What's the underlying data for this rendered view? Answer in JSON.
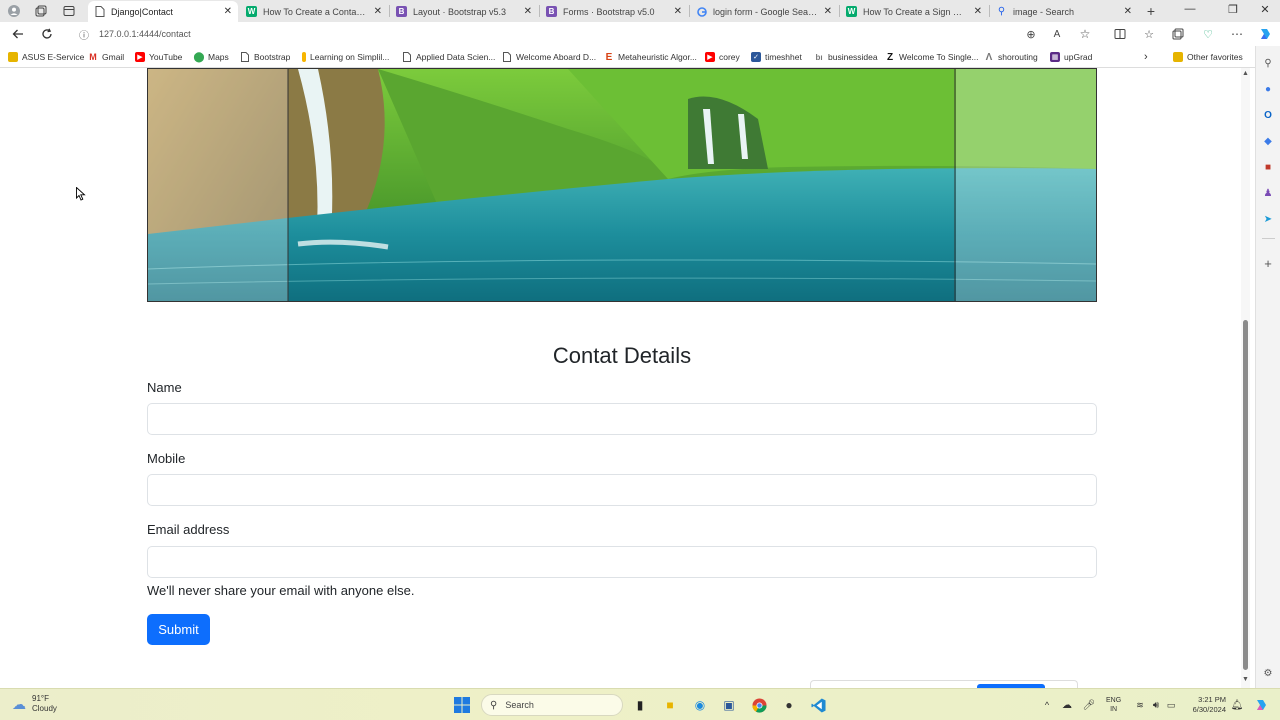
{
  "browser": {
    "tabs": [
      {
        "title": "Django|Contact",
        "active": true,
        "icon": "page-icon"
      },
      {
        "title": "How To Create a Contact Form",
        "active": false,
        "icon": "w-logo-icon"
      },
      {
        "title": "Layout · Bootstrap v5.3",
        "active": false,
        "icon": "bootstrap-logo-icon"
      },
      {
        "title": "Forms · Bootstrap v5.0",
        "active": false,
        "icon": "bootstrap-logo-icon"
      },
      {
        "title": "login form - Google Search",
        "active": false,
        "icon": "google-logo-icon"
      },
      {
        "title": "How To Create a Sign Up Form",
        "active": false,
        "icon": "w-logo-icon"
      },
      {
        "title": "image - Search",
        "active": false,
        "icon": "bing-search-icon"
      }
    ],
    "address": "127.0.0.1:4444/contact",
    "bookmarks": [
      {
        "label": "ASUS E-Service",
        "icon": "folder-icon"
      },
      {
        "label": "Gmail",
        "icon": "gmail-icon"
      },
      {
        "label": "YouTube",
        "icon": "youtube-icon"
      },
      {
        "label": "Maps",
        "icon": "maps-pin-icon"
      },
      {
        "label": "Bootstrap",
        "icon": "page-icon"
      },
      {
        "label": "Learning on Simplil...",
        "icon": "simplilearn-icon"
      },
      {
        "label": "Applied Data Scien...",
        "icon": "page-icon"
      },
      {
        "label": "Welcome Aboard D...",
        "icon": "page-icon"
      },
      {
        "label": "Metaheuristic Algor...",
        "icon": "e-logo-icon"
      },
      {
        "label": "corey",
        "icon": "youtube-icon"
      },
      {
        "label": "timeshhet",
        "icon": "timesheet-icon"
      },
      {
        "label": "businessidea",
        "icon": "link-icon"
      },
      {
        "label": "Welcome To Single...",
        "icon": "z-logo-icon"
      },
      {
        "label": "shorouting",
        "icon": "a-logo-icon"
      },
      {
        "label": "upGrad",
        "icon": "upgrad-icon"
      }
    ],
    "other_favorites": "Other favorites"
  },
  "page": {
    "form_title": "Contat Details",
    "fields": [
      {
        "label": "Name",
        "value": ""
      },
      {
        "label": "Mobile",
        "value": ""
      },
      {
        "label": "Email address",
        "value": ""
      }
    ],
    "email_help": "We'll never share your email with anyone else.",
    "submit_label": "Submit"
  },
  "taskbar": {
    "weather_temp": "91°F",
    "weather_desc": "Cloudy",
    "search_placeholder": "Search",
    "lang_top": "ENG",
    "lang_bottom": "IN",
    "time": "3:21 PM",
    "date": "6/30/2024"
  },
  "colors": {
    "primary": "#0d6efd",
    "input_border": "#dee2e6",
    "text": "#212529"
  }
}
